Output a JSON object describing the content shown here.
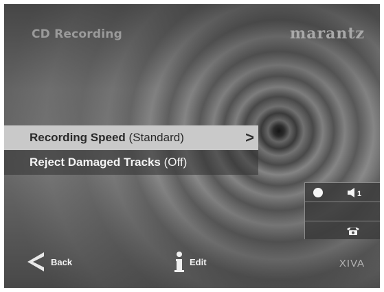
{
  "screen": {
    "title": "CD Recording",
    "brand": "marantz"
  },
  "menu": {
    "items": [
      {
        "name": "Recording Speed",
        "value": "(Standard)",
        "selected": true,
        "chevron": ">"
      },
      {
        "name": "Reject Damaged Tracks",
        "value": "(Off)",
        "selected": false
      }
    ]
  },
  "status": {
    "recording_icon": "record-dot-icon",
    "volume_icon": "speaker-volume-icon",
    "volume_level": "1",
    "phone_icon": "phone-icon"
  },
  "footer": {
    "back_label": "Back",
    "edit_label": "Edit",
    "platform": "XIVA"
  },
  "colors": {
    "selected_bg": "#c9c9c9",
    "selected_text": "#2a2a2a",
    "text": "#f2f2f2"
  }
}
